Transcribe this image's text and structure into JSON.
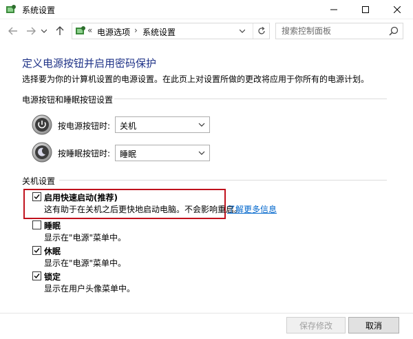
{
  "window": {
    "title": "系统设置"
  },
  "address": {
    "prefix": "«",
    "crumbs": [
      "电源选项",
      "系统设置"
    ],
    "separator": "›"
  },
  "search": {
    "placeholder": "搜索控制面板"
  },
  "page": {
    "title": "定义电源按钮并启用密码保护",
    "description": "选择要为你的计算机设置的电源设置。在此页上对设置所做的更改将应用于你所有的电源计划。"
  },
  "power_group": {
    "title": "电源按钮和睡眠按钮设置",
    "rows": [
      {
        "label": "按电源按钮时:",
        "value": "关机"
      },
      {
        "label": "按睡眠按钮时:",
        "value": "睡眠"
      }
    ]
  },
  "shutdown_group": {
    "title": "关机设置",
    "options": [
      {
        "title": "启用快速启动(推荐)",
        "desc": "这有助于在关机之后更快地启动电脑。不会影响重启。",
        "checked": true,
        "link": "了解更多信息"
      },
      {
        "title": "睡眠",
        "desc": "显示在\"电源\"菜单中。",
        "checked": false
      },
      {
        "title": "休眠",
        "desc": "显示在\"电源\"菜单中。",
        "checked": true
      },
      {
        "title": "锁定",
        "desc": "显示在用户头像菜单中。",
        "checked": true
      }
    ]
  },
  "footer": {
    "save": "保存修改",
    "cancel": "取消"
  },
  "colors": {
    "title_blue": "#1e3287",
    "link_blue": "#0066cc",
    "highlight_red": "#c0101c"
  }
}
